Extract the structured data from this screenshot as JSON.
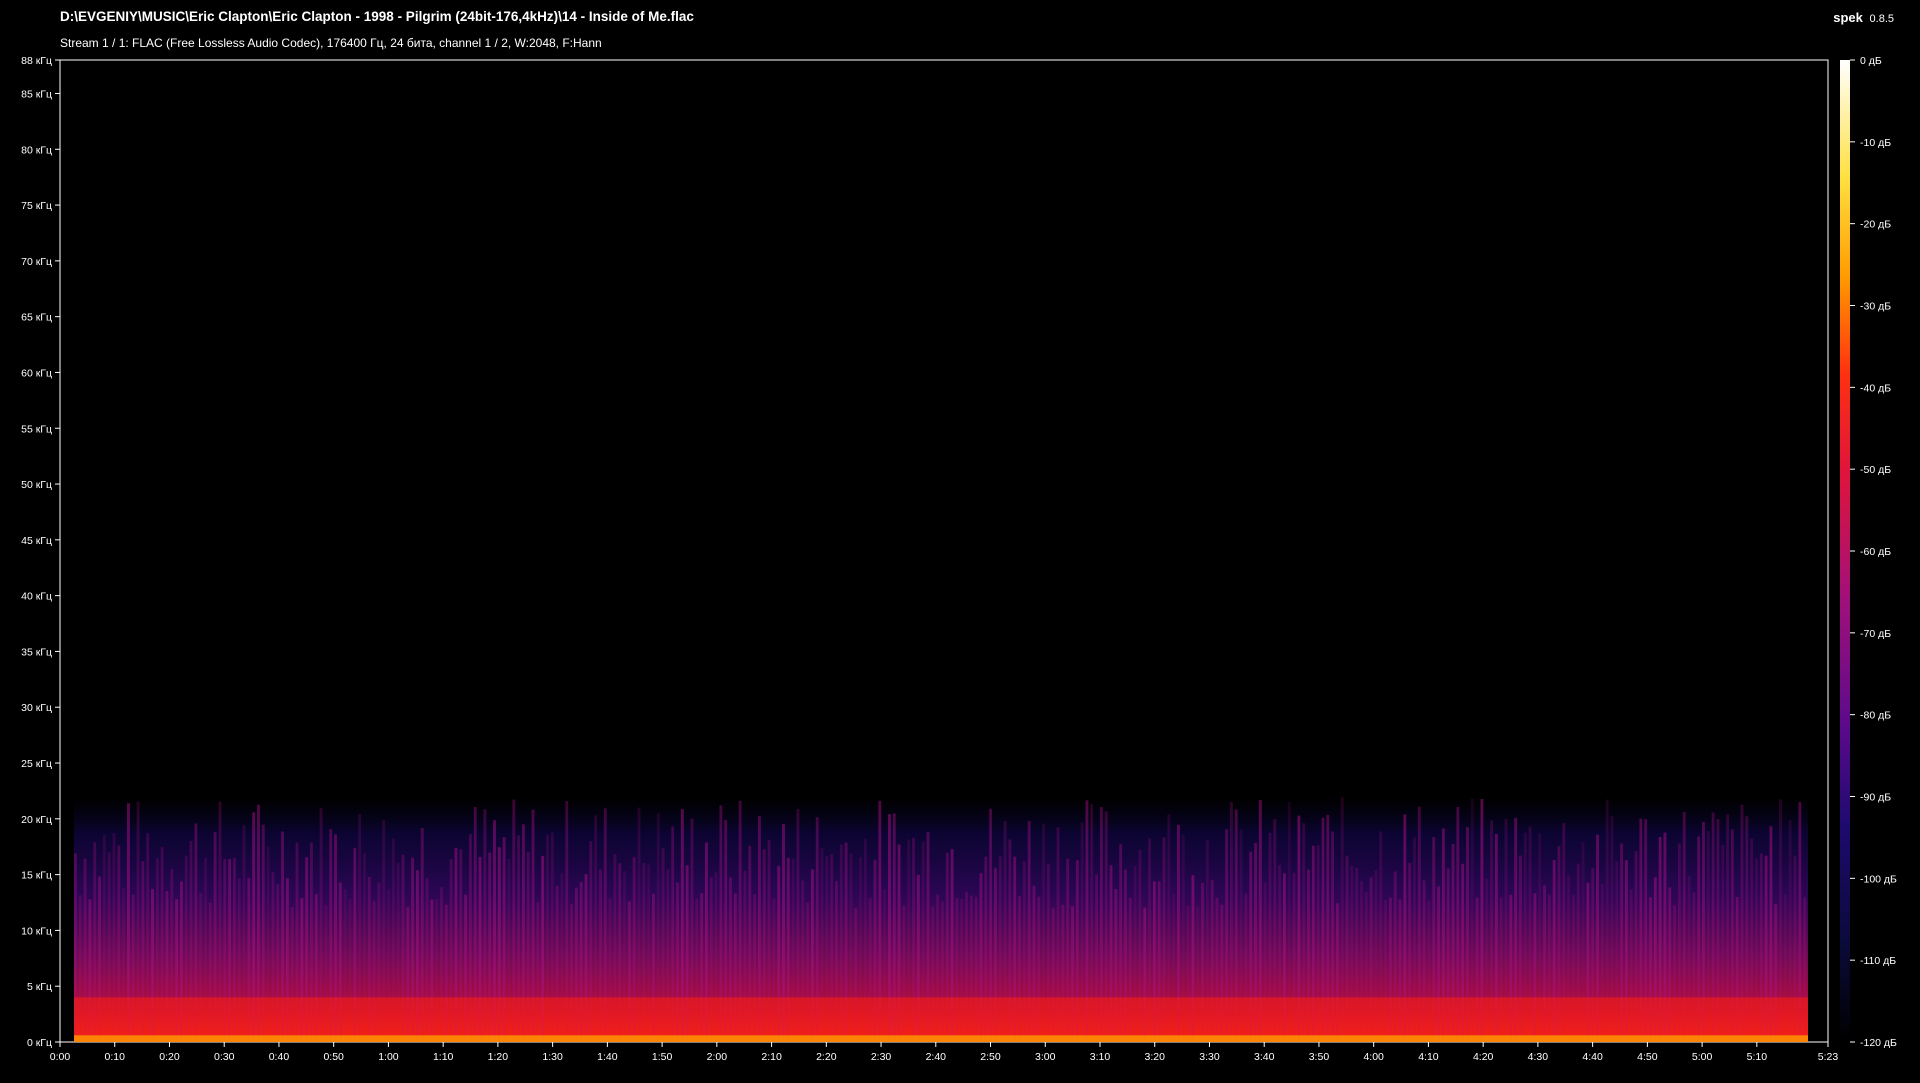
{
  "header": {
    "file_path": "D:\\EVGENIY\\MUSIC\\Eric Clapton\\Eric Clapton - 1998 - Pilgrim (24bit-176,4kHz)\\14 - Inside of Me.flac",
    "stream_info": "Stream 1 / 1: FLAC (Free Lossless Audio Codec), 176400 Гц, 24 бита, channel 1 / 2, W:2048, F:Hann",
    "app_name": "spek",
    "app_version": "0.8.5"
  },
  "colors": {
    "background": "#000000",
    "axis": "#ffffff",
    "palette": [
      "#000000",
      "#0a0a3a",
      "#1e0a6e",
      "#5a0a8c",
      "#a0107a",
      "#e0143c",
      "#ff3010",
      "#ff9c00",
      "#ffe040",
      "#ffffff"
    ]
  },
  "chart_data": {
    "type": "heatmap",
    "description_kind": "spectrogram",
    "x_unit": "time (m:ss)",
    "y_unit": "кГц",
    "xlim": [
      "0:00",
      "5:23"
    ],
    "ylim": [
      0,
      88
    ],
    "x_ticks": [
      "0:00",
      "0:10",
      "0:20",
      "0:30",
      "0:40",
      "0:50",
      "1:00",
      "1:10",
      "1:20",
      "1:30",
      "1:40",
      "1:50",
      "2:00",
      "2:10",
      "2:20",
      "2:30",
      "2:40",
      "2:50",
      "3:00",
      "3:10",
      "3:20",
      "3:30",
      "3:40",
      "3:50",
      "4:00",
      "4:10",
      "4:20",
      "4:30",
      "4:40",
      "4:50",
      "5:00",
      "5:10",
      "5:23"
    ],
    "x_tick_seconds": [
      0,
      10,
      20,
      30,
      40,
      50,
      60,
      70,
      80,
      90,
      100,
      110,
      120,
      130,
      140,
      150,
      160,
      170,
      180,
      190,
      200,
      210,
      220,
      230,
      240,
      250,
      260,
      270,
      280,
      290,
      300,
      310,
      323
    ],
    "y_ticks": [
      "0 кГц",
      "5 кГц",
      "10 кГц",
      "15 кГц",
      "20 кГц",
      "25 кГц",
      "30 кГц",
      "35 кГц",
      "40 кГц",
      "45 кГц",
      "50 кГц",
      "55 кГц",
      "60 кГц",
      "65 кГц",
      "70 кГц",
      "75 кГц",
      "80 кГц",
      "85 кГц",
      "88 кГц"
    ],
    "y_tick_values": [
      0,
      5,
      10,
      15,
      20,
      25,
      30,
      35,
      40,
      45,
      50,
      55,
      60,
      65,
      70,
      75,
      80,
      85,
      88
    ],
    "colorbar_ticks": [
      "0 дБ",
      "-10 дБ",
      "-20 дБ",
      "-30 дБ",
      "-40 дБ",
      "-50 дБ",
      "-60 дБ",
      "-70 дБ",
      "-80 дБ",
      "-90 дБ",
      "-100 дБ",
      "-110 дБ",
      "-120 дБ"
    ],
    "colorbar_values": [
      0,
      -10,
      -20,
      -30,
      -40,
      -50,
      -60,
      -70,
      -80,
      -90,
      -100,
      -110,
      -120
    ],
    "content_cutoff_khz": 22,
    "energy_band_khz": [
      0,
      10
    ],
    "duration_seconds": 323
  }
}
